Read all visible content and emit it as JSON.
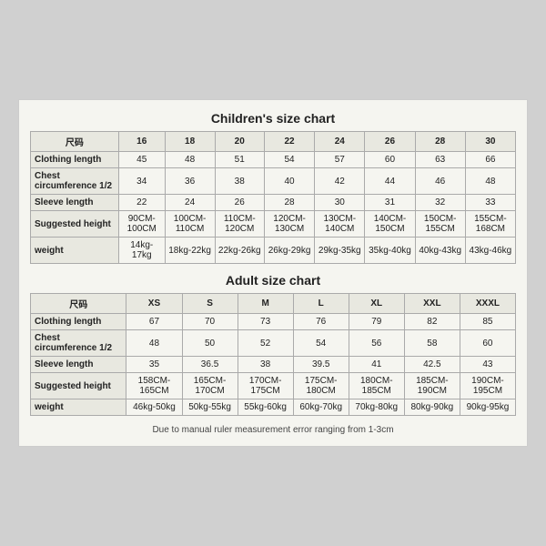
{
  "children_chart": {
    "title": "Children's size chart",
    "headers": [
      "尺码",
      "16",
      "18",
      "20",
      "22",
      "24",
      "26",
      "28",
      "30"
    ],
    "rows": [
      {
        "label": "Clothing length",
        "values": [
          "45",
          "48",
          "51",
          "54",
          "57",
          "60",
          "63",
          "66"
        ]
      },
      {
        "label": "Chest circumference 1/2",
        "values": [
          "34",
          "36",
          "38",
          "40",
          "42",
          "44",
          "46",
          "48"
        ]
      },
      {
        "label": "Sleeve length",
        "values": [
          "22",
          "24",
          "26",
          "28",
          "30",
          "31",
          "32",
          "33"
        ]
      },
      {
        "label": "Suggested height",
        "values": [
          "90CM-100CM",
          "100CM-110CM",
          "110CM-120CM",
          "120CM-130CM",
          "130CM-140CM",
          "140CM-150CM",
          "150CM-155CM",
          "155CM-168CM"
        ]
      },
      {
        "label": "weight",
        "values": [
          "14kg-17kg",
          "18kg-22kg",
          "22kg-26kg",
          "26kg-29kg",
          "29kg-35kg",
          "35kg-40kg",
          "40kg-43kg",
          "43kg-46kg"
        ]
      }
    ]
  },
  "adult_chart": {
    "title": "Adult size chart",
    "headers": [
      "尺码",
      "XS",
      "S",
      "M",
      "L",
      "XL",
      "XXL",
      "XXXL"
    ],
    "rows": [
      {
        "label": "Clothing length",
        "values": [
          "67",
          "70",
          "73",
          "76",
          "79",
          "82",
          "85"
        ]
      },
      {
        "label": "Chest circumference 1/2",
        "values": [
          "48",
          "50",
          "52",
          "54",
          "56",
          "58",
          "60"
        ]
      },
      {
        "label": "Sleeve length",
        "values": [
          "35",
          "36.5",
          "38",
          "39.5",
          "41",
          "42.5",
          "43"
        ]
      },
      {
        "label": "Suggested height",
        "values": [
          "158CM-165CM",
          "165CM-170CM",
          "170CM-175CM",
          "175CM-180CM",
          "180CM-185CM",
          "185CM-190CM",
          "190CM-195CM"
        ]
      },
      {
        "label": "weight",
        "values": [
          "46kg-50kg",
          "50kg-55kg",
          "55kg-60kg",
          "60kg-70kg",
          "70kg-80kg",
          "80kg-90kg",
          "90kg-95kg"
        ]
      }
    ]
  },
  "footer": {
    "note": "Due to manual ruler measurement error ranging from 1-3cm"
  }
}
